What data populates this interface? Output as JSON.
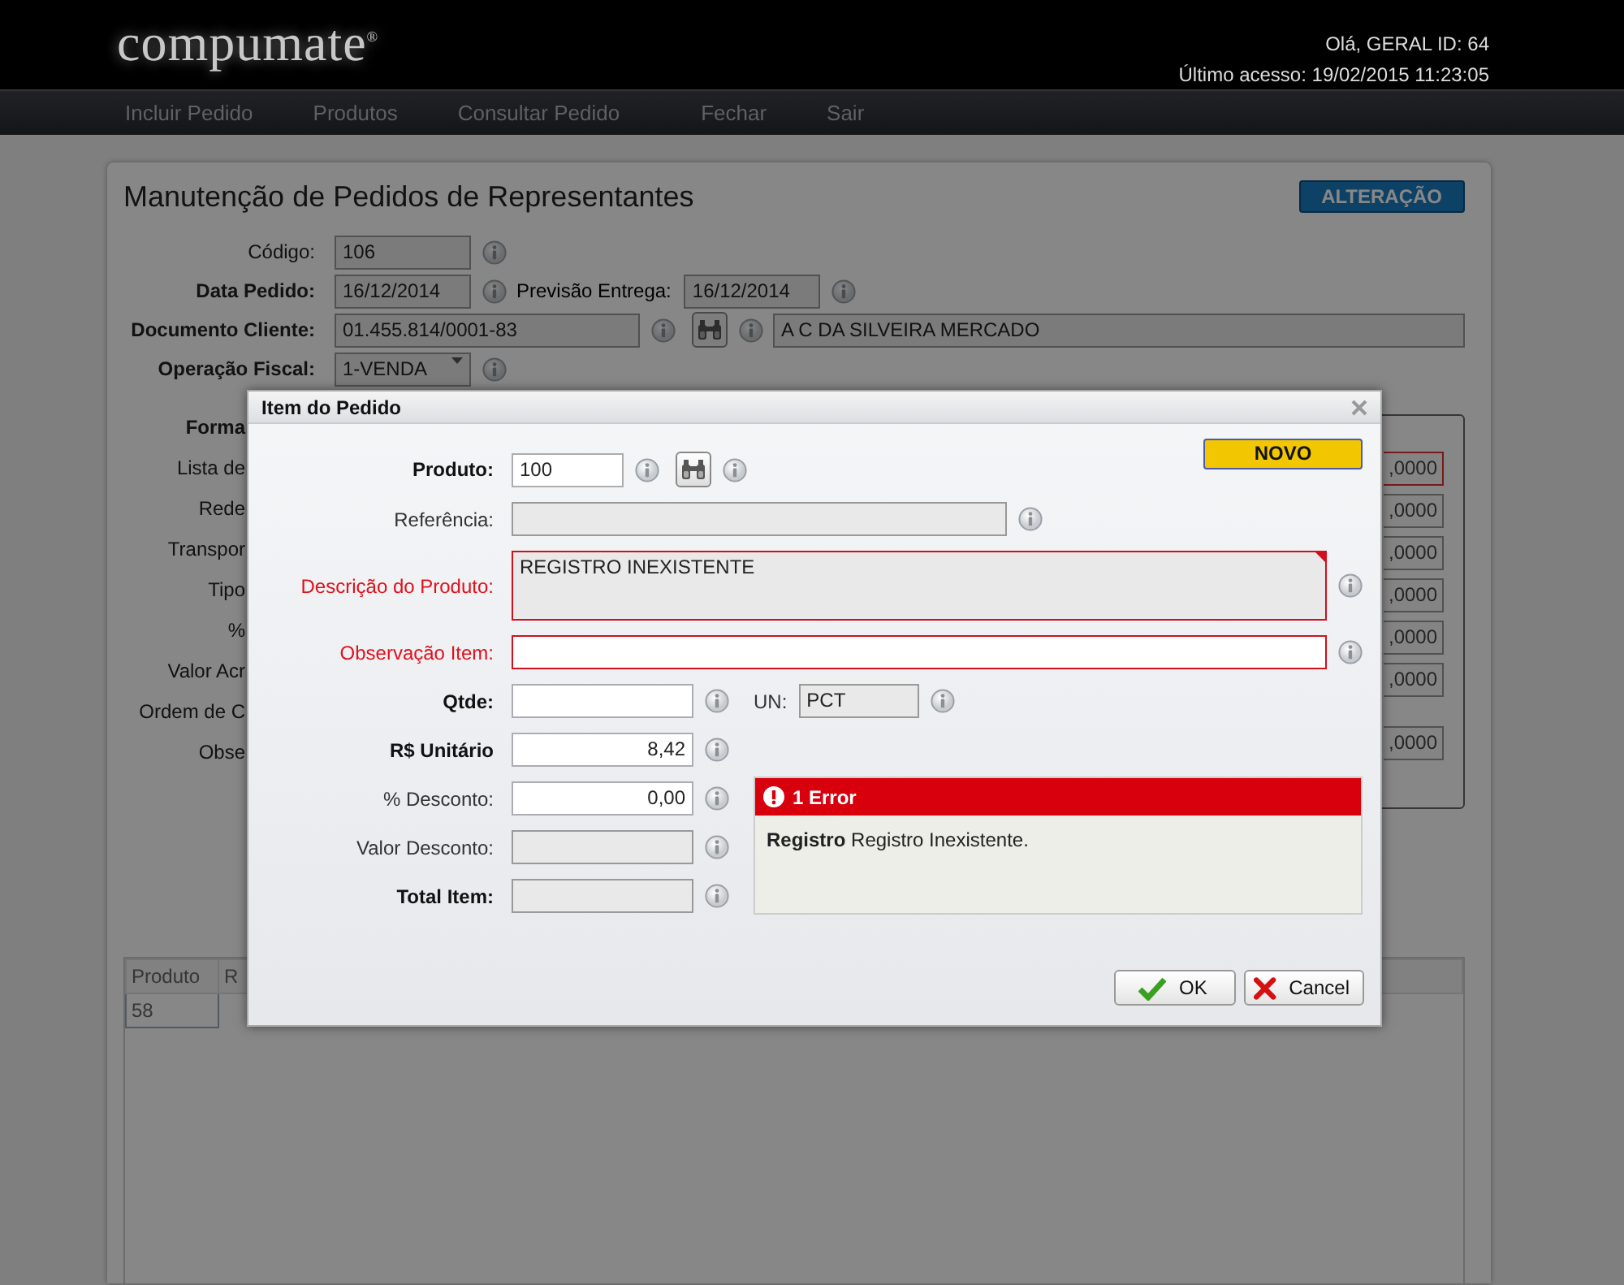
{
  "header": {
    "logo": "compumate$^{®}$",
    "greeting": "Olá, GERAL ID: 64",
    "last_access": "Último acesso: 19/02/2015 11:23:05"
  },
  "nav": [
    {
      "label": "Incluir Pedido"
    },
    {
      "label": "Produtos"
    },
    {
      "label": "Consultar Pedido"
    },
    {
      "label": "Fechar"
    },
    {
      "label": "Sair"
    }
  ],
  "page": {
    "title": "Manutenção de Pedidos de Representantes",
    "mode": "ALTERAÇÃO",
    "fields": [
      {
        "kind": "single",
        "label": "Código:",
        "required": false,
        "value": "106"
      },
      {
        "kind": "pair",
        "label": "Data Pedido:",
        "required": true,
        "value": "16/12/2014",
        "second_label": "Previsão Entrega:",
        "second_value": "16/12/2014"
      },
      {
        "kind": "lookup",
        "label": "Documento Cliente:",
        "required": true,
        "value": "01.455.814/0001-83",
        "result": "A C DA SILVEIRA MERCADO"
      },
      {
        "kind": "select",
        "label": "Operação Fiscal:",
        "required": true,
        "value": "1-VENDA"
      }
    ],
    "partial_labels": [
      {
        "text": "Forma",
        "required": true
      },
      {
        "text": "Lista de",
        "required": false
      },
      {
        "text": "Rede",
        "required": false
      },
      {
        "text": "Transpor",
        "required": false
      },
      {
        "text": "Tipo",
        "required": false
      },
      {
        "text": "%",
        "required": false
      },
      {
        "text": "Valor Acr",
        "required": false
      },
      {
        "text": "Ordem de C",
        "required": false
      },
      {
        "text": "Obse",
        "required": false
      }
    ],
    "partial_values": [
      {
        "text": ",0000",
        "invalid": true
      },
      {
        "text": ",0000",
        "invalid": false
      },
      {
        "text": ",0000",
        "invalid": false
      },
      {
        "text": ",0000",
        "invalid": false
      },
      {
        "text": ",0000",
        "invalid": false
      },
      {
        "text": ",0000",
        "invalid": false
      },
      {
        "text": ",0000",
        "invalid": false
      }
    ],
    "table": {
      "columns": [
        "Produto",
        "R"
      ],
      "rows": [
        [
          "58"
        ]
      ]
    }
  },
  "dialog": {
    "title": "Item do Pedido",
    "status": "NOVO",
    "rows": [
      {
        "kind": "product",
        "label": "Produto:",
        "required": true,
        "invalid": false,
        "disabled": false,
        "value": "100"
      },
      {
        "kind": "wide",
        "label": "Referência:",
        "required": false,
        "invalid": false,
        "disabled": true
      },
      {
        "kind": "memo",
        "label": "Descrição do Produto:",
        "required": false,
        "invalid": true,
        "disabled": true,
        "value": "REGISTRO INEXISTENTE"
      },
      {
        "kind": "full",
        "label": "Observação Item:",
        "required": false,
        "invalid": true,
        "disabled": false
      },
      {
        "kind": "unit",
        "label": "Qtde:",
        "required": true,
        "invalid": false,
        "disabled": false,
        "unit_label": "UN:",
        "unit_value": "PCT"
      },
      {
        "kind": "number",
        "label": "R$ Unitário",
        "required": true,
        "invalid": false,
        "disabled": false,
        "value": "8,42"
      },
      {
        "kind": "number",
        "label": "% Desconto:",
        "required": false,
        "invalid": false,
        "disabled": false,
        "value": "0,00"
      },
      {
        "kind": "number",
        "label": "Valor Desconto:",
        "required": false,
        "invalid": false,
        "disabled": true
      },
      {
        "kind": "number",
        "label": "Total Item:",
        "required": true,
        "invalid": false,
        "disabled": true
      }
    ],
    "error": {
      "title": "1 Error",
      "message": "**Registro** Registro Inexistente."
    },
    "buttons": [
      {
        "kind": "ok",
        "label": "OK"
      },
      {
        "kind": "cancel",
        "label": "Cancel"
      }
    ]
  }
}
